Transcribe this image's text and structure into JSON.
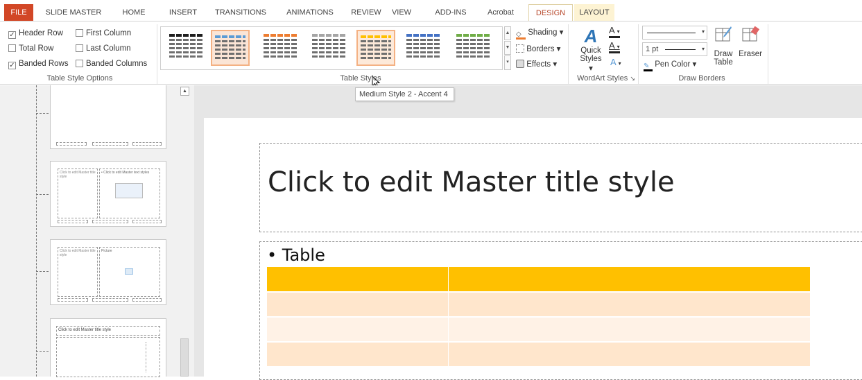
{
  "tabs": [
    {
      "label": "FILE"
    },
    {
      "label": "SLIDE MASTER"
    },
    {
      "label": "HOME"
    },
    {
      "label": "INSERT"
    },
    {
      "label": "TRANSITIONS"
    },
    {
      "label": "ANIMATIONS"
    },
    {
      "label": "REVIEW"
    },
    {
      "label": "VIEW"
    },
    {
      "label": "ADD-INS"
    },
    {
      "label": "Acrobat"
    },
    {
      "label": "DESIGN"
    },
    {
      "label": "LAYOUT"
    }
  ],
  "table_style_options": {
    "label": "Table Style Options",
    "items": [
      {
        "label": "Header Row",
        "checked": true,
        "mark": "✓"
      },
      {
        "label": "First Column",
        "checked": false,
        "mark": ""
      },
      {
        "label": "Total Row",
        "checked": false,
        "mark": ""
      },
      {
        "label": "Last Column",
        "checked": false,
        "mark": ""
      },
      {
        "label": "Banded Rows",
        "checked": true,
        "mark": "✓"
      },
      {
        "label": "Banded Columns",
        "checked": false,
        "mark": ""
      }
    ]
  },
  "table_styles": {
    "label": "Table Styles",
    "swatches": [
      {
        "name": "dark",
        "color": "#1f1f1f"
      },
      {
        "name": "accent1",
        "color": "#5b9bd5"
      },
      {
        "name": "accent2",
        "color": "#ed7d31"
      },
      {
        "name": "accent3",
        "color": "#a5a5a5"
      },
      {
        "name": "accent4",
        "color": "#ffc000"
      },
      {
        "name": "accent5",
        "color": "#4472c4"
      },
      {
        "name": "accent6",
        "color": "#70ad47"
      }
    ],
    "shading": "Shading",
    "borders": "Borders",
    "effects": "Effects"
  },
  "wordart": {
    "label": "WordArt Styles",
    "quick_styles": "Quick",
    "quick_styles2": "Styles"
  },
  "draw_borders": {
    "label": "Draw Borders",
    "pen_weight": "1 pt",
    "pen_color": "Pen Color",
    "draw_table": "Draw",
    "draw_table2": "Table",
    "eraser": "Eraser"
  },
  "tooltip": "Medium Style 2 - Accent 4",
  "slide": {
    "title": "Click to edit Master title style",
    "bullet": "• Table",
    "table": {
      "header_color": "#ffc000",
      "band1": "#ffe6cc",
      "band2": "#fff2e6",
      "rows": 4,
      "cols": 2
    }
  },
  "thumbnails": [
    {
      "title": "Click to edit Master title style",
      "body": "• Click to edit Master text styles"
    },
    {
      "title": "Click to edit Master title style",
      "body": "Picture"
    },
    {
      "title": "Click to edit Master title style",
      "body": ""
    }
  ],
  "colors": {
    "file_tab": "#d24726",
    "design_tab_text": "#b7472a",
    "accent": "#ffc000"
  }
}
